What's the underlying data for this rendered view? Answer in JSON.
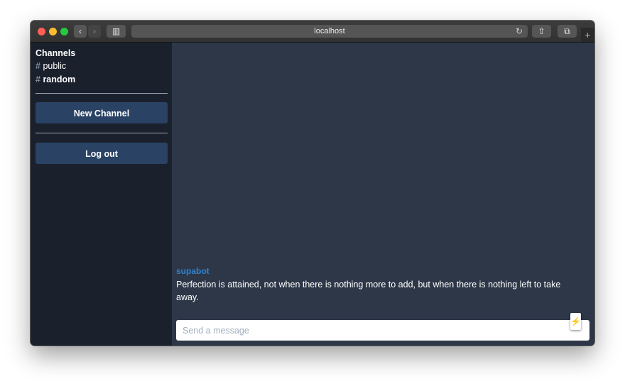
{
  "browser": {
    "url": "localhost",
    "icons": {
      "back": "‹",
      "forward": "›",
      "sidebar_toggle": "▥",
      "reload": "↻",
      "share": "⇧",
      "tabs": "⧉",
      "new_tab": "+"
    }
  },
  "sidebar": {
    "title": "Channels",
    "channels": [
      {
        "hash": "#",
        "name": "public"
      },
      {
        "hash": "#",
        "name": "random"
      }
    ],
    "new_channel_label": "New Channel",
    "logout_label": "Log out"
  },
  "messages": [
    {
      "user": "supabot",
      "text": "Perfection is attained, not when there is nothing more to add, but when there is nothing left to take away."
    }
  ],
  "composer": {
    "placeholder": "Send a message",
    "value": ""
  },
  "widget": {
    "icon": "⚡"
  },
  "colors": {
    "sidebar_bg": "#1a202c",
    "main_bg": "#2d3748",
    "button_bg": "#2a4365",
    "username": "#3182ce"
  }
}
